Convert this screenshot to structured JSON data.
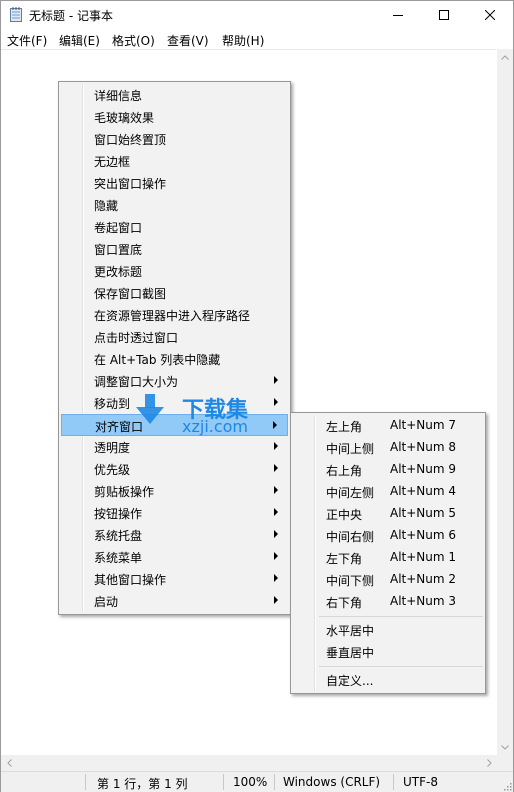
{
  "window": {
    "title": "无标题 - 记事本",
    "controls": {
      "minimize": "minimize",
      "maximize": "maximize",
      "close": "close"
    }
  },
  "menubar": [
    "文件(F)",
    "编辑(E)",
    "格式(O)",
    "查看(V)",
    "帮助(H)"
  ],
  "context_menu": {
    "items": [
      {
        "label": "详细信息",
        "submenu": false
      },
      {
        "label": "毛玻璃效果",
        "submenu": false
      },
      {
        "label": "窗口始终置顶",
        "submenu": false
      },
      {
        "label": "无边框",
        "submenu": false
      },
      {
        "label": "突出窗口操作",
        "submenu": false
      },
      {
        "label": "隐藏",
        "submenu": false
      },
      {
        "label": "卷起窗口",
        "submenu": false
      },
      {
        "label": "窗口置底",
        "submenu": false
      },
      {
        "label": "更改标题",
        "submenu": false
      },
      {
        "label": "保存窗口截图",
        "submenu": false
      },
      {
        "label": "在资源管理器中进入程序路径",
        "submenu": false
      },
      {
        "label": "点击时透过窗口",
        "submenu": false
      },
      {
        "label": "在 Alt+Tab 列表中隐藏",
        "submenu": false
      },
      {
        "label": "调整窗口大小为",
        "submenu": true
      },
      {
        "label": "移动到",
        "submenu": true
      },
      {
        "label": "对齐窗口",
        "submenu": true,
        "highlighted": true
      },
      {
        "label": "透明度",
        "submenu": true
      },
      {
        "label": "优先级",
        "submenu": true
      },
      {
        "label": "剪贴板操作",
        "submenu": true
      },
      {
        "label": "按钮操作",
        "submenu": true
      },
      {
        "label": "系统托盘",
        "submenu": true
      },
      {
        "label": "系统菜单",
        "submenu": true
      },
      {
        "label": "其他窗口操作",
        "submenu": true
      },
      {
        "label": "启动",
        "submenu": true
      }
    ]
  },
  "align_submenu": {
    "positions": [
      {
        "label": "左上角",
        "shortcut": "Alt+Num 7"
      },
      {
        "label": "中间上侧",
        "shortcut": "Alt+Num 8"
      },
      {
        "label": "右上角",
        "shortcut": "Alt+Num 9"
      },
      {
        "label": "中间左侧",
        "shortcut": "Alt+Num 4"
      },
      {
        "label": "正中央",
        "shortcut": "Alt+Num 5"
      },
      {
        "label": "中间右侧",
        "shortcut": "Alt+Num 6"
      },
      {
        "label": "左下角",
        "shortcut": "Alt+Num 1"
      },
      {
        "label": "中间下侧",
        "shortcut": "Alt+Num 2"
      },
      {
        "label": "右下角",
        "shortcut": "Alt+Num 3"
      }
    ],
    "centering": [
      "水平居中",
      "垂直居中"
    ],
    "custom": "自定义..."
  },
  "statusbar": {
    "position": "第 1 行，第 1 列",
    "zoom": "100%",
    "line_ending": "Windows (CRLF)",
    "encoding": "UTF-8"
  },
  "watermark": {
    "brand": "下载集",
    "domain": "xzji.com"
  },
  "colors": {
    "highlight": "#91c9f7",
    "menu_bg": "#f2f2f2",
    "watermark_blue": "#1e88e5"
  }
}
